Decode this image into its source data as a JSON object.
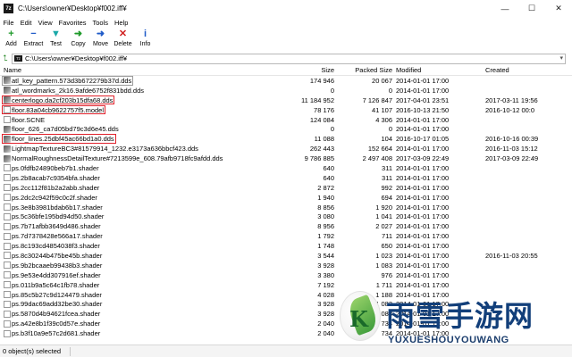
{
  "window": {
    "app_icon_text": "7z",
    "title": "C:\\Users\\owner¥Desktop¥f002.iff¥",
    "controls": [
      "—",
      "☐",
      "✕"
    ]
  },
  "menu": [
    "File",
    "Edit",
    "View",
    "Favorites",
    "Tools",
    "Help"
  ],
  "toolbar": [
    {
      "label": "Add",
      "icon": "plus-icon",
      "glyph": "+",
      "color": "#1e9a2a"
    },
    {
      "label": "Extract",
      "icon": "minus-icon",
      "glyph": "−",
      "color": "#1e5ac8"
    },
    {
      "label": "Test",
      "icon": "check-icon",
      "glyph": "▼",
      "color": "#1aa8a8"
    },
    {
      "label": "Copy",
      "icon": "copy-arrow-icon",
      "glyph": "➜",
      "color": "#1e9a2a"
    },
    {
      "label": "Move",
      "icon": "move-arrow-icon",
      "glyph": "➜",
      "color": "#1e5ac8"
    },
    {
      "label": "Delete",
      "icon": "delete-x-icon",
      "glyph": "✕",
      "color": "#d02020"
    },
    {
      "label": "Info",
      "icon": "info-icon",
      "glyph": "i",
      "color": "#1e5ac8"
    }
  ],
  "address": {
    "path": "C:\\Users\\owner¥Desktop¥f002.iff¥",
    "mini_icon": "7z"
  },
  "columns": {
    "name": "Name",
    "size": "Size",
    "packed": "Packed Size",
    "modified": "Modified",
    "created": "Created"
  },
  "files": [
    {
      "name": "atl_key_pattern.573d3b672279b37d.dds",
      "type": "dds",
      "size": "174 946",
      "packed": "20 067",
      "modified": "2014-01-01 17:00",
      "created": "",
      "mark": "outline"
    },
    {
      "name": "atl_wordmarks_2k16.9afde6752f831bdd.dds",
      "type": "dds",
      "size": "0",
      "packed": "0",
      "modified": "2014-01-01 17:00",
      "created": "",
      "mark": ""
    },
    {
      "name": "centerlogo.da2cf203b15dfa68.dds",
      "type": "dds",
      "size": "11 184 952",
      "packed": "7 126 847",
      "modified": "2017-04-01 23:51",
      "created": "2017-03-11 19:56",
      "mark": "red"
    },
    {
      "name": "floor.83a04cb9622757f5.model",
      "type": "model",
      "size": "78 176",
      "packed": "41 107",
      "modified": "2016-10-13 21:50",
      "created": "2016-10-12 00:0",
      "mark": "red"
    },
    {
      "name": "floor.SCNE",
      "type": "plain",
      "size": "124 084",
      "packed": "4 306",
      "modified": "2014-01-01 17:00",
      "created": "",
      "mark": ""
    },
    {
      "name": "floor_626_ca7d05bd79c3d6e45.dds",
      "type": "dds",
      "size": "0",
      "packed": "0",
      "modified": "2014-01-01 17:00",
      "created": "",
      "mark": ""
    },
    {
      "name": "floor_lines.25dbf45ac66bd1a0.dds",
      "type": "dds",
      "size": "11 088",
      "packed": "104",
      "modified": "2016-10-17 01:05",
      "created": "2016-10-16 00:39",
      "mark": "red"
    },
    {
      "name": "LightmapTextureBC3#81579914_1232.e3173a636bbcf423.dds",
      "type": "dds",
      "size": "262 443",
      "packed": "152 664",
      "modified": "2014-01-01 17:00",
      "created": "2016-11-03 15:12",
      "mark": ""
    },
    {
      "name": "NormalRoughnessDetailTexture#7213599e_608.79afb9718fc9afdd.dds",
      "type": "dds",
      "size": "9 786 885",
      "packed": "2 497 408",
      "modified": "2017-03-09 22:49",
      "created": "2017-03-09 22:49",
      "mark": ""
    },
    {
      "name": "ps.0fdfb24890beb7b1.shader",
      "type": "shader",
      "size": "640",
      "packed": "311",
      "modified": "2014-01-01 17:00",
      "created": "",
      "mark": ""
    },
    {
      "name": "ps.2b8acab7c9354bfa.shader",
      "type": "shader",
      "size": "640",
      "packed": "311",
      "modified": "2014-01-01 17:00",
      "created": "",
      "mark": ""
    },
    {
      "name": "ps.2cc112f81b2a2abb.shader",
      "type": "shader",
      "size": "2 872",
      "packed": "992",
      "modified": "2014-01-01 17:00",
      "created": "",
      "mark": ""
    },
    {
      "name": "ps.2dc2c942f59c0c2f.shader",
      "type": "shader",
      "size": "1 940",
      "packed": "694",
      "modified": "2014-01-01 17:00",
      "created": "",
      "mark": ""
    },
    {
      "name": "ps.3e8b3981bdab6b17.shader",
      "type": "shader",
      "size": "8 856",
      "packed": "1 920",
      "modified": "2014-01-01 17:00",
      "created": "",
      "mark": ""
    },
    {
      "name": "ps.5c36bfe195bd94d50.shader",
      "type": "shader",
      "size": "3 080",
      "packed": "1 041",
      "modified": "2014-01-01 17:00",
      "created": "",
      "mark": ""
    },
    {
      "name": "ps.7b71afbb3649d486.shader",
      "type": "shader",
      "size": "8 956",
      "packed": "2 027",
      "modified": "2014-01-01 17:00",
      "created": "",
      "mark": ""
    },
    {
      "name": "ps.7d7378428e566a17.shader",
      "type": "shader",
      "size": "1 792",
      "packed": "711",
      "modified": "2014-01-01 17:00",
      "created": "",
      "mark": ""
    },
    {
      "name": "ps.8c193cd4854038f3.shader",
      "type": "shader",
      "size": "1 748",
      "packed": "650",
      "modified": "2014-01-01 17:00",
      "created": "",
      "mark": ""
    },
    {
      "name": "ps.8c30244b475be45b.shader",
      "type": "shader",
      "size": "3 544",
      "packed": "1 023",
      "modified": "2014-01-01 17:00",
      "created": "2016-11-03 20:55",
      "mark": ""
    },
    {
      "name": "ps.9b2bcaaeb99438b3.shader",
      "type": "shader",
      "size": "3 928",
      "packed": "1 083",
      "modified": "2014-01-01 17:00",
      "created": "",
      "mark": ""
    },
    {
      "name": "ps.9e53e4dd307916ef.shader",
      "type": "shader",
      "size": "3 380",
      "packed": "976",
      "modified": "2014-01-01 17:00",
      "created": "",
      "mark": ""
    },
    {
      "name": "ps.011b9a5c64c1fb78.shader",
      "type": "shader",
      "size": "7 192",
      "packed": "1 711",
      "modified": "2014-01-01 17:00",
      "created": "",
      "mark": ""
    },
    {
      "name": "ps.85c5b27c9d124479.shader",
      "type": "shader",
      "size": "4 028",
      "packed": "1 188",
      "modified": "2014-01-01 17:00",
      "created": "",
      "mark": ""
    },
    {
      "name": "ps.99dac69add32be30.shader",
      "type": "shader",
      "size": "3 928",
      "packed": "1 083",
      "modified": "2014-01-01 17:00",
      "created": "",
      "mark": ""
    },
    {
      "name": "ps.5870d4b94621fcea.shader",
      "type": "shader",
      "size": "3 928",
      "packed": "1 083",
      "modified": "2014-01-01 17:00",
      "created": "",
      "mark": ""
    },
    {
      "name": "ps.a42e8b1f39c0d57e.shader",
      "type": "shader",
      "size": "2 040",
      "packed": "734",
      "modified": "2014-01-01 17:00",
      "created": "",
      "mark": ""
    },
    {
      "name": "ps.b3f10a9e57c2d681.shader",
      "type": "shader",
      "size": "2 040",
      "packed": "734",
      "modified": "2014-01-01 17:00",
      "created": "",
      "mark": ""
    }
  ],
  "status": {
    "selected": "0 object(s) selected"
  },
  "watermark": {
    "cn": "雨雪手游网",
    "en": "YUXUESHOUYOUWANG",
    "en2": "DDMGME",
    "logo_letter": "K"
  }
}
